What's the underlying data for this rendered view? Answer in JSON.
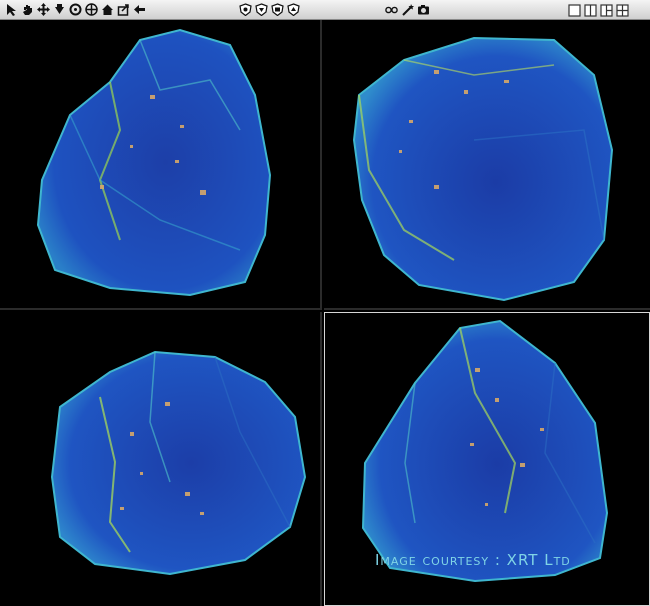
{
  "toolbar": {
    "left_tools": [
      "select-arrow-icon",
      "hand-pan-icon",
      "move-cross-icon",
      "rotate-down-icon",
      "rotate-orbit-icon",
      "move-axes-icon",
      "home-icon",
      "export-icon",
      "back-arrow-icon"
    ],
    "middle_tools": [
      "view-shield-1-icon",
      "view-shield-2-icon",
      "view-shield-3-icon",
      "view-shield-4-icon"
    ],
    "right_tools": [
      "stereo-glasses-icon",
      "wand-icon",
      "camera-icon"
    ],
    "layouts": [
      "layout-single-icon",
      "layout-two-col-icon",
      "layout-three-icon",
      "layout-quad-icon"
    ]
  },
  "viewports": [
    {
      "name": "viewport-top-left"
    },
    {
      "name": "viewport-top-right"
    },
    {
      "name": "viewport-bottom-left"
    },
    {
      "name": "viewport-bottom-right"
    }
  ],
  "credit_text": "Image courtesy : XRT Ltd",
  "colors": {
    "background": "#000000",
    "gem_blue": "#1f4bb8",
    "gem_edge": "#35c1d4",
    "highlight_green": "#b5e05a",
    "inclusion": "#d9a96a",
    "credit": "#7fd4e6"
  }
}
